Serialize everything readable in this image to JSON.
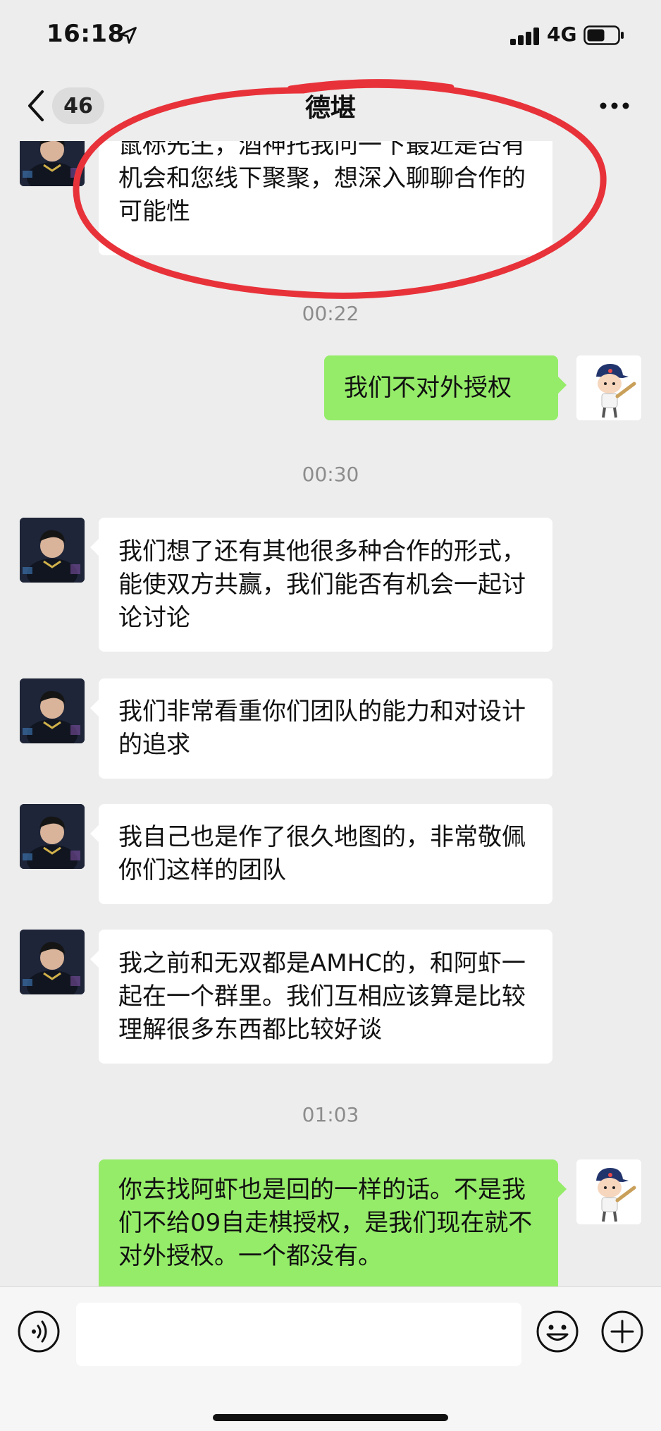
{
  "status_bar": {
    "time": "16:18",
    "network": "4G"
  },
  "nav": {
    "unread_count": "46",
    "title": "德堪"
  },
  "messages": [
    {
      "side": "left",
      "text": "鼠标先生，酒神托我问一下最近是否有机会和您线下聚聚，想深入聊聊合作的可能性"
    },
    {
      "side": "time",
      "text": "00:22"
    },
    {
      "side": "right",
      "text": "我们不对外授权"
    },
    {
      "side": "time",
      "text": "00:30"
    },
    {
      "side": "left",
      "text": "我们想了还有其他很多种合作的形式，能使双方共赢，我们能否有机会一起讨论讨论"
    },
    {
      "side": "left",
      "text": "我们非常看重你们团队的能力和对设计的追求"
    },
    {
      "side": "left",
      "text": "我自己也是作了很久地图的，非常敬佩你们这样的团队"
    },
    {
      "side": "left",
      "text": "我之前和无双都是AMHC的，和阿虾一起在一个群里。我们互相应该算是比较理解很多东西都比较好谈"
    },
    {
      "side": "time",
      "text": "01:03"
    },
    {
      "side": "right",
      "text": "你去找阿虾也是回的一样的话。不是我们不给09自走棋授权，是我们现在就不对外授权。一个都没有。"
    }
  ],
  "colors": {
    "background": "#ededed",
    "bubble_outgoing": "#95ec69",
    "bubble_incoming": "#ffffff",
    "annotation_circle": "#e8323a"
  },
  "icons": [
    "location-arrow-icon",
    "signal-icon",
    "battery-icon",
    "back-chevron-icon",
    "more-dots-icon",
    "voice-icon",
    "emoji-icon",
    "plus-icon"
  ]
}
